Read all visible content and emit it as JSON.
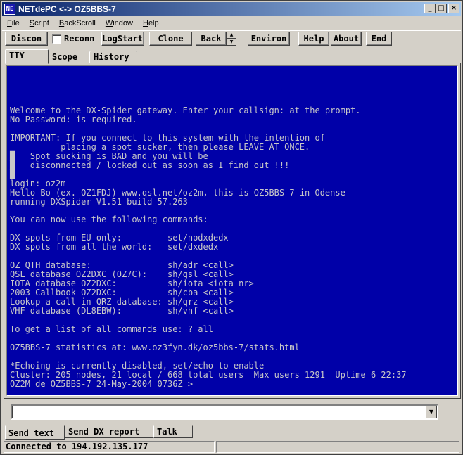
{
  "window": {
    "title": "NETdePC <-> OZ5BBS-7",
    "controls": {
      "minimize": "_",
      "maximize": "□",
      "close": "×"
    }
  },
  "menu": {
    "items": [
      {
        "label": "File",
        "key": "F",
        "rest": "ile"
      },
      {
        "label": "Script",
        "key": "S",
        "rest": "cript"
      },
      {
        "label": "BackScroll",
        "key": "B",
        "rest": "ackScroll"
      },
      {
        "label": "Window",
        "key": "W",
        "rest": "indow"
      },
      {
        "label": "Help",
        "key": "H",
        "rest": "elp"
      }
    ]
  },
  "toolbar": {
    "discon": "Discon",
    "reconnect": "Reconn",
    "logstart": "LogStart",
    "clone": "Clone",
    "back": "Back",
    "environ": "Environ",
    "help": "Help",
    "about": "About",
    "end": "End"
  },
  "tabs_top": [
    "TTY",
    "Scope",
    "History"
  ],
  "terminal": {
    "lines": [
      "Welcome to the DX-Spider gateway. Enter your callsign: at the prompt.",
      "No Password: is required.",
      "",
      "IMPORTANT: If you connect to this system with the intention of",
      "          placing a spot sucker, then please LEAVE AT ONCE.",
      "█   Spot sucking is BAD and you will be",
      "█   disconnected / locked out as soon as I find out !!!",
      "█",
      "login: oz2m",
      "Hello Bo (ex. OZ1FDJ) www.qsl.net/oz2m, this is OZ5BBS-7 in Odense",
      "running DXSpider V1.51 build 57.263",
      "",
      "You can now use the following commands:",
      "",
      "DX spots from EU only:         set/nodxdedx",
      "DX spots from all the world:   set/dxdedx",
      "",
      "OZ QTH database:               sh/adr <call>",
      "QSL database OZ2DXC (OZ7C):    sh/qsl <call>",
      "IOTA database OZ2DXC:          sh/iota <iota nr>",
      "2003 Callbook OZ2DXC:          sh/cba <call>",
      "Lookup a call in QRZ database: sh/qrz <call>",
      "VHF database (DL8EBW):         sh/vhf <call>",
      "",
      "To get a list of all commands use: ? all",
      "",
      "OZ5BBS-7 statistics at: www.oz3fyn.dk/oz5bbs-7/stats.html",
      "",
      "*Echoing is currently disabled, set/echo to enable",
      "Cluster: 205 nodes, 21 local / 668 total users  Max users 1291  Uptime 6 22:37",
      "OZ2M de OZ5BBS-7 24-May-2004 0736Z >"
    ]
  },
  "input": {
    "value": "",
    "dropdown_icon": "▼"
  },
  "tabs_bottom": [
    "Send text",
    "Send DX report",
    "Talk"
  ],
  "status": {
    "connection": "Connected to 194.192.135.177"
  }
}
